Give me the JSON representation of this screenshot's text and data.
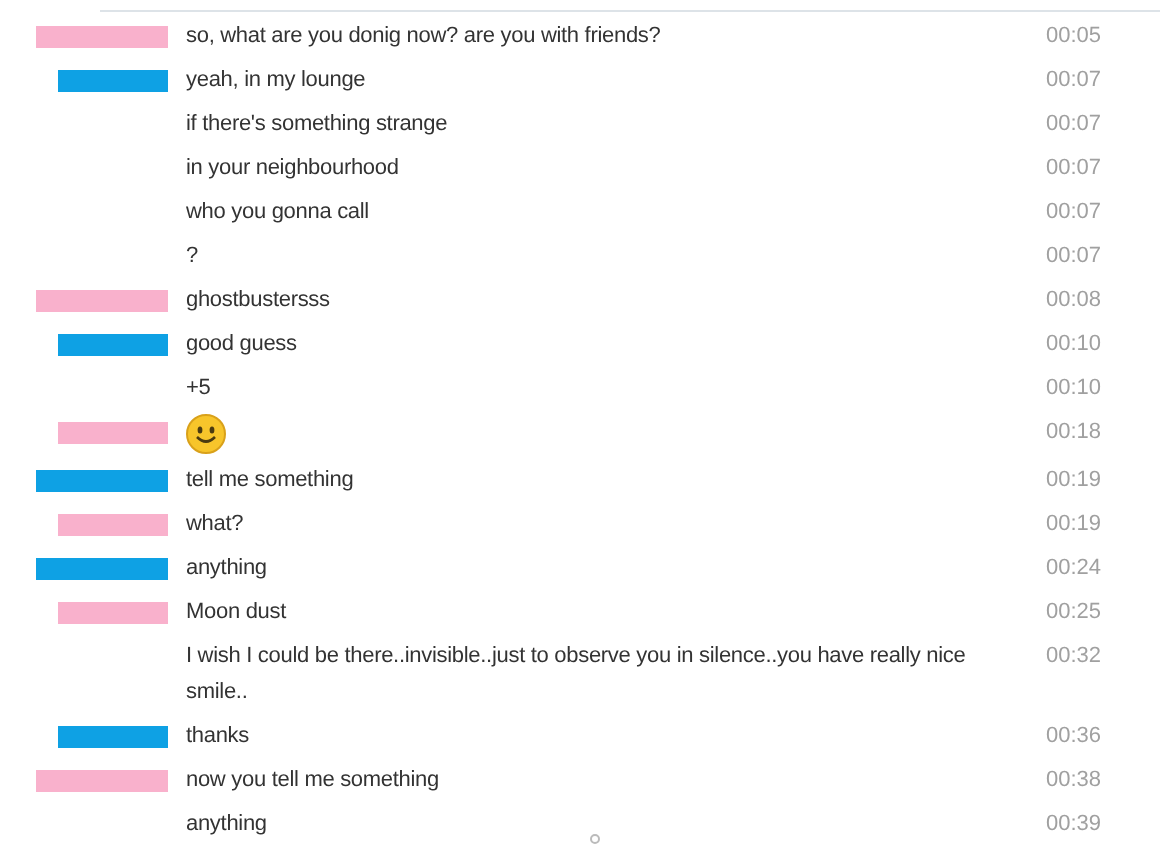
{
  "messages": [
    {
      "kind": "text",
      "sender": {
        "color": "#f9b1cc"
      },
      "text": "so, what are you donig now? are you with friends?",
      "time": "00:05"
    },
    {
      "kind": "text",
      "sender": {
        "color": "#0ea1e4"
      },
      "text": "yeah, in my lounge",
      "time": "00:07"
    },
    {
      "kind": "text",
      "text": "if there's something strange",
      "time": "00:07"
    },
    {
      "kind": "text",
      "text": "in your neighbourhood",
      "time": "00:07"
    },
    {
      "kind": "text",
      "text": "who you gonna call",
      "time": "00:07"
    },
    {
      "kind": "text",
      "text": "?",
      "time": "00:07"
    },
    {
      "kind": "text",
      "sender": {
        "color": "#f9b1cc"
      },
      "text": "ghostbustersss",
      "time": "00:08"
    },
    {
      "kind": "text",
      "sender": {
        "color": "#0ea1e4"
      },
      "text": "good guess",
      "time": "00:10"
    },
    {
      "kind": "text",
      "text": "+5",
      "time": "00:10"
    },
    {
      "kind": "smiley",
      "sender": {
        "color": "#f9b1cc"
      },
      "time": "00:18"
    },
    {
      "kind": "text",
      "sender": {
        "color": "#0ea1e4"
      },
      "text": "tell me something",
      "time": "00:19"
    },
    {
      "kind": "text",
      "sender": {
        "color": "#f9b1cc"
      },
      "text": "what?",
      "time": "00:19"
    },
    {
      "kind": "text",
      "sender": {
        "color": "#0ea1e4"
      },
      "text": "anything",
      "time": "00:24"
    },
    {
      "kind": "text",
      "sender": {
        "color": "#f9b1cc"
      },
      "text": "Moon dust",
      "time": "00:25"
    },
    {
      "kind": "text",
      "text": "I wish I could be there..invisible..just to observe you in silence..you have really nice smile..",
      "time": "00:32"
    },
    {
      "kind": "text",
      "sender": {
        "color": "#0ea1e4"
      },
      "text": "thanks",
      "time": "00:36"
    },
    {
      "kind": "text",
      "sender": {
        "color": "#f9b1cc"
      },
      "text": "now you tell me something",
      "time": "00:38"
    },
    {
      "kind": "text",
      "text": "anything",
      "time": "00:39"
    }
  ]
}
